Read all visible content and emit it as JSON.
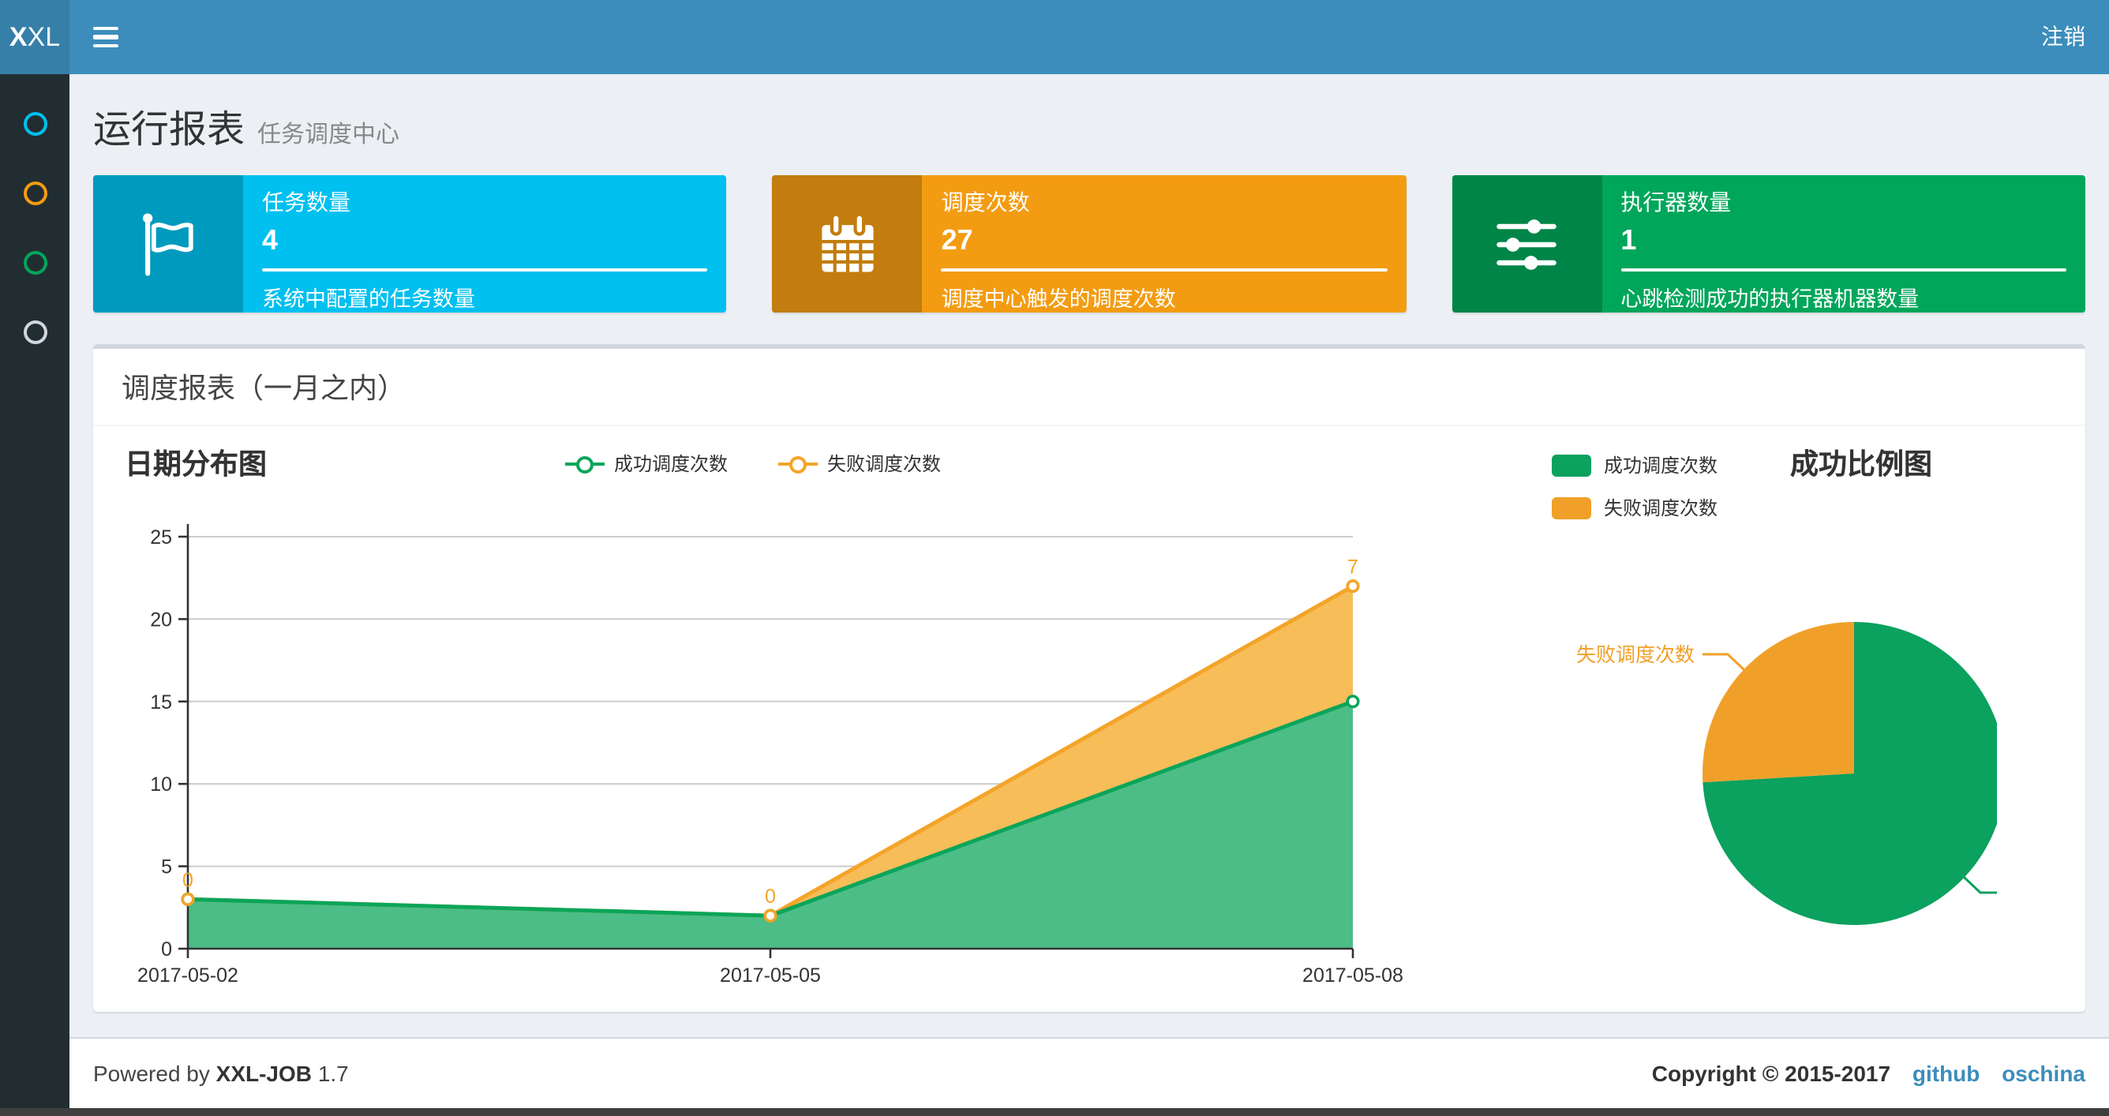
{
  "header": {
    "logo_bold": "X",
    "logo_rest": "XL",
    "logout_label": "注销",
    "navbar_color": "#3c8dbc",
    "logo_bg_color": "#367fa9"
  },
  "sidebar": {
    "bg_color": "#222d32",
    "items": [
      {
        "icon": "circle-icon",
        "color": "#00c0ef"
      },
      {
        "icon": "circle-icon",
        "color": "#f39c12"
      },
      {
        "icon": "circle-icon",
        "color": "#00a65a"
      },
      {
        "icon": "circle-icon",
        "color": "#d2d6de"
      }
    ]
  },
  "page": {
    "title": "运行报表",
    "subtitle": "任务调度中心"
  },
  "stats": [
    {
      "label": "任务数量",
      "value": "4",
      "description": "系统中配置的任务数量",
      "color": "#00c0ef",
      "icon_bg": "#009abf",
      "icon": "flag-icon"
    },
    {
      "label": "调度次数",
      "value": "27",
      "description": "调度中心触发的调度次数",
      "color": "#f39c12",
      "icon_bg": "#c27d0e",
      "icon": "calendar-icon"
    },
    {
      "label": "执行器数量",
      "value": "1",
      "description": "心跳检测成功的执行器机器数量",
      "color": "#00a65a",
      "icon_bg": "#008548",
      "icon": "sliders-icon"
    }
  ],
  "panel": {
    "title": "调度报表（一月之内）"
  },
  "chart_data": [
    {
      "type": "area",
      "title": "日期分布图",
      "categories": [
        "2017-05-02",
        "2017-05-05",
        "2017-05-08"
      ],
      "series": [
        {
          "name": "成功调度次数",
          "values": [
            3,
            2,
            15
          ],
          "color": "#0aa55a",
          "fill": "#4cbd86"
        },
        {
          "name": "失败调度次数",
          "values": [
            0,
            0,
            7
          ],
          "color": "#f4a428",
          "fill": "#f6bd59"
        }
      ],
      "stacked": true,
      "point_labels": {
        "series": "失败调度次数",
        "values": [
          "0",
          "0",
          "7"
        ]
      },
      "xlabel": "",
      "ylabel": "",
      "ylim": [
        0,
        25
      ],
      "ytick_step": 5,
      "grid": true,
      "legend_position": "top-center",
      "axis_color": "#333333",
      "grid_color": "#cccccc"
    },
    {
      "type": "pie",
      "title": "成功比例图",
      "slices": [
        {
          "name": "成功调度次数",
          "value": 20,
          "color": "#0ba15e"
        },
        {
          "name": "失败调度次数",
          "value": 7,
          "color": "#f0a029"
        }
      ],
      "start_angle": "top",
      "direction": "clockwise",
      "legend_position": "top-left",
      "labels": "outside-with-leader-lines"
    }
  ],
  "footer": {
    "powered_prefix": "Powered by",
    "app_name": "XXL-JOB",
    "version": "1.7",
    "copyright": "Copyright © 2015-2017",
    "links": [
      {
        "label": "github"
      },
      {
        "label": "oschina"
      }
    ]
  }
}
